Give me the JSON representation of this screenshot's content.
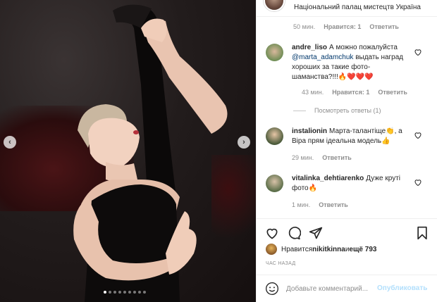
{
  "location": {
    "text": "Національний палац мистецтв Україна"
  },
  "top_meta": {
    "time": "50 мин.",
    "likes": "Нравится: 1",
    "reply": "Ответить"
  },
  "comments": [
    {
      "user": "andre_liso",
      "text_before": "А можно пожалуйста ",
      "mention": "@marta_adamchuk",
      "text_after": " выдать наград хороших за такие фото-шаманства?!!!🔥❤️❤️❤️",
      "time": "43 мин.",
      "likes": "Нравится: 1",
      "reply": "Ответить"
    },
    {
      "user": "instalionin",
      "text": "Марта-талантіще👏, а Віра прям ідеальна модель👍",
      "time": "29 мин.",
      "reply": "Ответить"
    },
    {
      "user": "vitalinka_dehtiarenko",
      "text": "Дуже круті фото🔥",
      "time": "1 мин.",
      "reply": "Ответить"
    }
  ],
  "view_replies": "Посмотреть ответы (1)",
  "likes": {
    "prefix": "Нравится ",
    "user": "nikitkinna",
    "middle": " и ",
    "others": "ещё 793"
  },
  "time_ago": "ЧАС НАЗАД",
  "add_comment": {
    "placeholder": "Добавьте комментарий...",
    "publish": "Опубликовать"
  },
  "carousel": {
    "count": 9,
    "active_index": 0
  },
  "icons": {
    "prev": "chevron-left-icon",
    "next": "chevron-right-icon",
    "like": "heart-icon",
    "comment": "speech-bubble-icon",
    "share": "paper-plane-icon",
    "save": "bookmark-icon",
    "emoji": "smiley-icon"
  },
  "colors": {
    "link": "#00376b",
    "publish_disabled": "#b2dffc",
    "muted": "#8e8e8e"
  }
}
